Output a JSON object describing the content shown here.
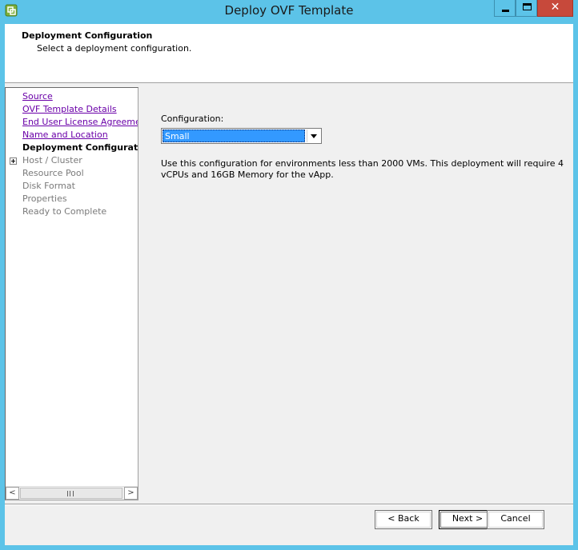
{
  "window": {
    "title": "Deploy OVF Template",
    "close_glyph": "✕",
    "icons": {
      "app": "vsphere-app-icon",
      "minimize": "minimize-icon",
      "maximize": "maximize-icon",
      "close": "close-icon"
    }
  },
  "header": {
    "title": "Deployment Configuration",
    "subtitle": "Select a deployment configuration."
  },
  "nav": {
    "items": [
      {
        "label": "Source",
        "state": "link"
      },
      {
        "label": "OVF Template Details",
        "state": "link"
      },
      {
        "label": "End User License Agreement",
        "state": "link"
      },
      {
        "label": "Name and Location",
        "state": "link"
      },
      {
        "label": "Deployment Configuration",
        "state": "current"
      },
      {
        "label": "Host / Cluster",
        "state": "disabled",
        "expandable": true
      },
      {
        "label": "Resource Pool",
        "state": "disabled"
      },
      {
        "label": "Disk Format",
        "state": "disabled"
      },
      {
        "label": "Properties",
        "state": "disabled"
      },
      {
        "label": "Ready to Complete",
        "state": "disabled"
      }
    ],
    "scroll_left": "<",
    "scroll_right": ">"
  },
  "main": {
    "config_label": "Configuration:",
    "config_selected": "Small",
    "description": "Use this configuration for environments less than 2000 VMs.  This deployment will require 4 vCPUs and 16GB Memory for the vApp."
  },
  "footer": {
    "back_label": "< Back",
    "next_label": "Next >",
    "cancel_label": "Cancel"
  },
  "colors": {
    "frame": "#5cc3e8",
    "close_button": "#c7493b",
    "selection": "#3399ff",
    "visited_link": "#6a00a8"
  }
}
